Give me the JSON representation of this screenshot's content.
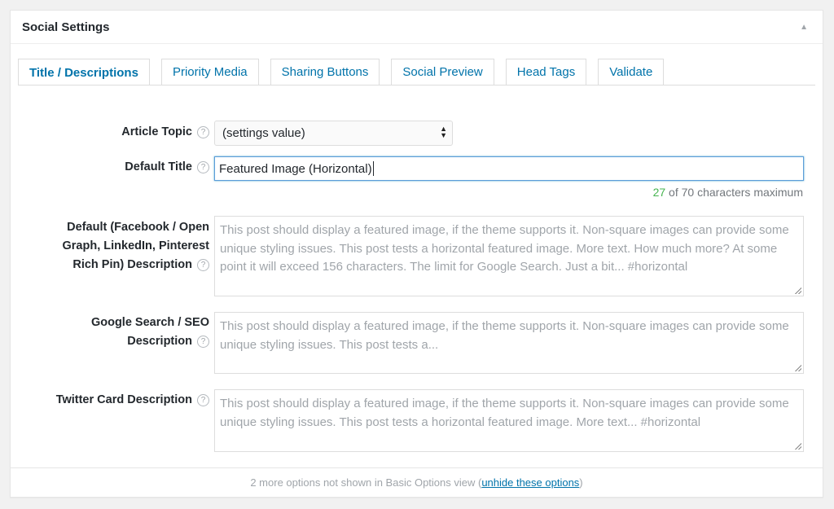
{
  "panel": {
    "title": "Social Settings",
    "collapse_icon": "triangle-up-icon"
  },
  "tabs": [
    {
      "label": "Title / Descriptions",
      "active": true
    },
    {
      "label": "Priority Media"
    },
    {
      "label": "Sharing Buttons"
    },
    {
      "label": "Social Preview"
    },
    {
      "label": "Head Tags"
    },
    {
      "label": "Validate"
    }
  ],
  "fields": {
    "article_topic": {
      "label": "Article Topic",
      "value": "(settings value)"
    },
    "default_title": {
      "label": "Default Title",
      "value": "Featured Image (Horizontal)",
      "counter_current": "27",
      "counter_suffix": " of 70 characters maximum"
    },
    "og_description": {
      "label_line1": "Default (Facebook / Open",
      "label_line2": "Graph, LinkedIn, Pinterest",
      "label_line3": "Rich Pin) Description",
      "placeholder": "This post should display a featured image, if the theme supports it. Non-square images can provide some unique styling issues. This post tests a horizontal featured image. More text. How much more? At some point it will exceed 156 characters. The limit for Google Search. Just a bit... #horizontal"
    },
    "seo_description": {
      "label_line1": "Google Search / SEO",
      "label_line2": "Description",
      "placeholder": "This post should display a featured image, if the theme supports it. Non-square images can provide some unique styling issues. This post tests a..."
    },
    "twitter_description": {
      "label": "Twitter Card Description",
      "placeholder": "This post should display a featured image, if the theme supports it. Non-square images can provide some unique styling issues. This post tests a horizontal featured image. More text... #horizontal"
    }
  },
  "help_glyph": "?",
  "footer": {
    "text": "2 more options not shown in Basic Options view (",
    "link": "unhide these options",
    "close": ")"
  },
  "colors": {
    "accent": "#0073aa",
    "counter_ok": "#46b450",
    "focus": "#5b9dd9"
  }
}
